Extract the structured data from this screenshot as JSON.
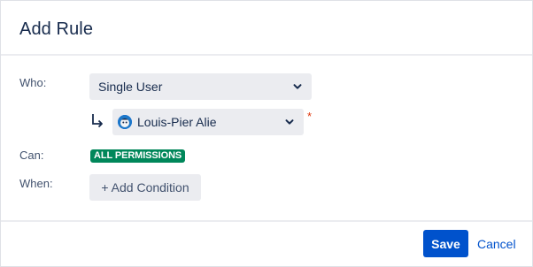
{
  "dialog": {
    "title": "Add Rule"
  },
  "form": {
    "who_label": "Who:",
    "who_value": "Single User",
    "user_value": "Louis-Pier Alie",
    "required_marker": "*",
    "can_label": "Can:",
    "permission_badge": "ALL PERMISSIONS",
    "when_label": "When:",
    "add_condition_label": "+ Add Condition"
  },
  "footer": {
    "save_label": "Save",
    "cancel_label": "Cancel"
  },
  "icons": {
    "who_dropdown": "chevron-down-icon",
    "user_dropdown": "chevron-down-icon",
    "indent_arrow": "arrow-down-right-icon",
    "user_avatar": "avatar"
  },
  "colors": {
    "primary": "#0052cc",
    "badge_green": "#00875a",
    "required_red": "#de350b",
    "field_bg": "#ebecf0"
  }
}
